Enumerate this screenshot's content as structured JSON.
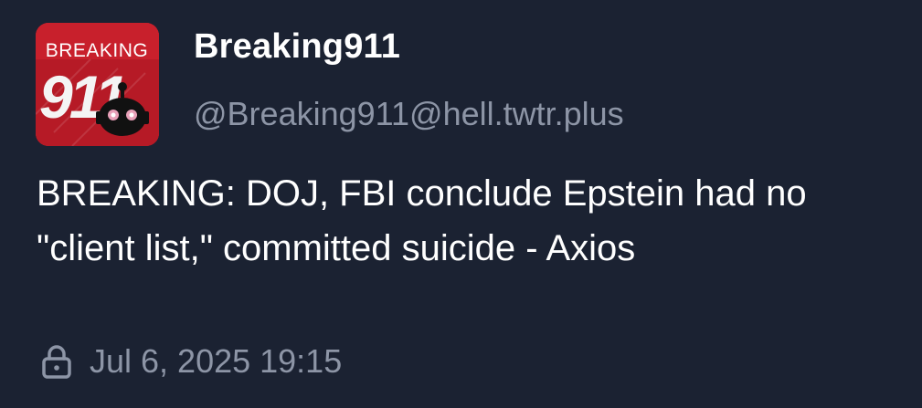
{
  "post": {
    "avatar": {
      "logo_word": "BREAKING",
      "logo_number": "911",
      "icon": "robot-icon"
    },
    "author": {
      "display_name": "Breaking911",
      "handle": "@Breaking911@hell.twtr.plus"
    },
    "content": "BREAKING: DOJ, FBI conclude Epstein had no \"client list,\" committed suicide - Axios",
    "visibility_icon": "lock-icon",
    "timestamp": "Jul 6, 2025 19:15"
  },
  "colors": {
    "background": "#1b2232",
    "text_primary": "#ffffff",
    "text_secondary": "#8d95a6",
    "avatar_brand": "#c8202c"
  }
}
